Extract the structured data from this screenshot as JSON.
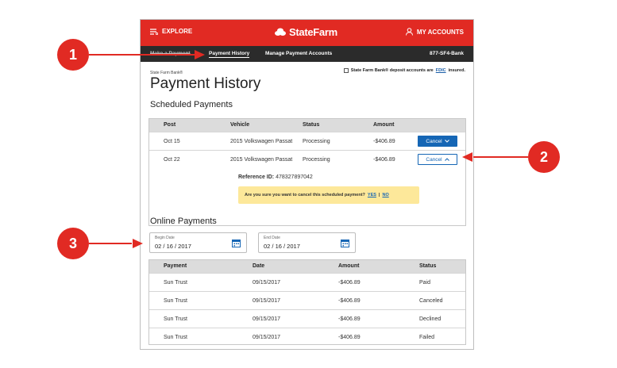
{
  "header": {
    "explore_label": "EXPLORE",
    "logo_text": "StateFarm",
    "accounts_label": "MY ACCOUNTS",
    "brand_color": "#e12a23"
  },
  "subnav": {
    "make_payment": "Make a Payment",
    "payment_history": "Payment History",
    "manage_accounts": "Manage Payment Accounts",
    "phone": "877-SF4-Bank"
  },
  "page": {
    "bank_label": "State Farm Bank®",
    "title": "Payment History",
    "fdic_prefix": "State Farm Bank® deposit accounts are",
    "fdic_link": "FDIC",
    "fdic_suffix": "insured."
  },
  "scheduled": {
    "title": "Scheduled Payments",
    "columns": [
      "Post",
      "Vehicle",
      "Status",
      "Amount"
    ],
    "rows": [
      {
        "post": "Oct 15",
        "vehicle": "2015 Volkswagen Passat",
        "status": "Processing",
        "amount": "-$406.89",
        "action": "Cancel"
      },
      {
        "post": "Oct 22",
        "vehicle": "2015 Volkswagen Passat",
        "status": "Processing",
        "amount": "-$406.89",
        "action": "Cancel"
      }
    ],
    "reference_label": "Reference ID:",
    "reference_value": "478327897042",
    "confirm_text": "Are you sure you want to cancel this scheduled payment?",
    "confirm_yes": "YES",
    "confirm_sep": "|",
    "confirm_no": "NO"
  },
  "online": {
    "title": "Online Payments",
    "begin_label": "Begin Date",
    "begin_value": "02 / 16 / 2017",
    "end_label": "End Date",
    "end_value": "02 / 16 / 2017",
    "columns": [
      "Payment",
      "Date",
      "Amount",
      "Status"
    ],
    "rows": [
      {
        "payment": "Sun Trust",
        "date": "09/15/2017",
        "amount": "-$406.89",
        "status": "Paid"
      },
      {
        "payment": "Sun Trust",
        "date": "09/15/2017",
        "amount": "-$406.89",
        "status": "Canceled"
      },
      {
        "payment": "Sun Trust",
        "date": "09/15/2017",
        "amount": "-$406.89",
        "status": "Declined"
      },
      {
        "payment": "Sun Trust",
        "date": "09/15/2017",
        "amount": "-$406.89",
        "status": "Failed"
      }
    ]
  },
  "callouts": [
    "1",
    "2",
    "3"
  ]
}
